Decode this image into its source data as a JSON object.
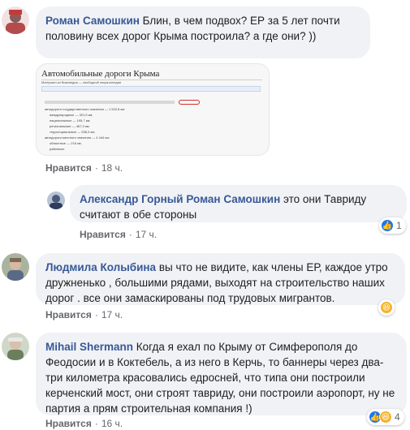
{
  "comments": [
    {
      "author": "Роман Самошкин",
      "text": "Блин, в чем подвох? ЕР за 5 лет почти половину всех дорог Крыма построила? а где они? ))",
      "like_label": "Нравится",
      "time": "18 ч.",
      "attachment": {
        "title": "Автомобильные дороги Крыма",
        "subtitle": "Материал из Википедии — свободной энциклопедии",
        "lines": [
          "автодороги государственного значения — 1 522,8 км:",
          "международные — 321,5 км;",
          "национальные — 195,7 км;",
          "региональные — 467,3 км;",
          "территориальные — 538,3 км;",
          "автодороги местного значения — 4 444 км:",
          "областные — 216 км;",
          "районные"
        ]
      }
    },
    {
      "author": "Александр Горный",
      "mention": "Роман Самошкин",
      "text": "это они Тавриду считают в обе стороны",
      "like_label": "Нравится",
      "time": "17 ч.",
      "reactions": {
        "count": "1"
      }
    },
    {
      "author": "Людмила Колыбина",
      "text": "вы что не видите, как члены ЕР, каждое утро дружненько , большими рядами, выходят на строительство наших дорог . все они замаскированы под трудовых мигрантов.",
      "like_label": "Нравится",
      "time": "17 ч."
    },
    {
      "author": "Mihail Shermann",
      "text": "Когда я ехал по Крыму от Симферополя до Феодосии и в Коктебель, а из него в Керчь, то баннеры через два-три километра красовались едросней, что типа они построили керченский мост, они строят тавриду, они построили аэропорт, ну не партия а прям строительная компания !)",
      "like_label": "Нравится",
      "time": "16 ч.",
      "reactions": {
        "count": "4"
      }
    }
  ],
  "colors": {
    "bubble": "#f0f2f5",
    "author": "#385898",
    "meta": "#65676b",
    "like": "#1877f2",
    "haha": "#f7b125"
  }
}
